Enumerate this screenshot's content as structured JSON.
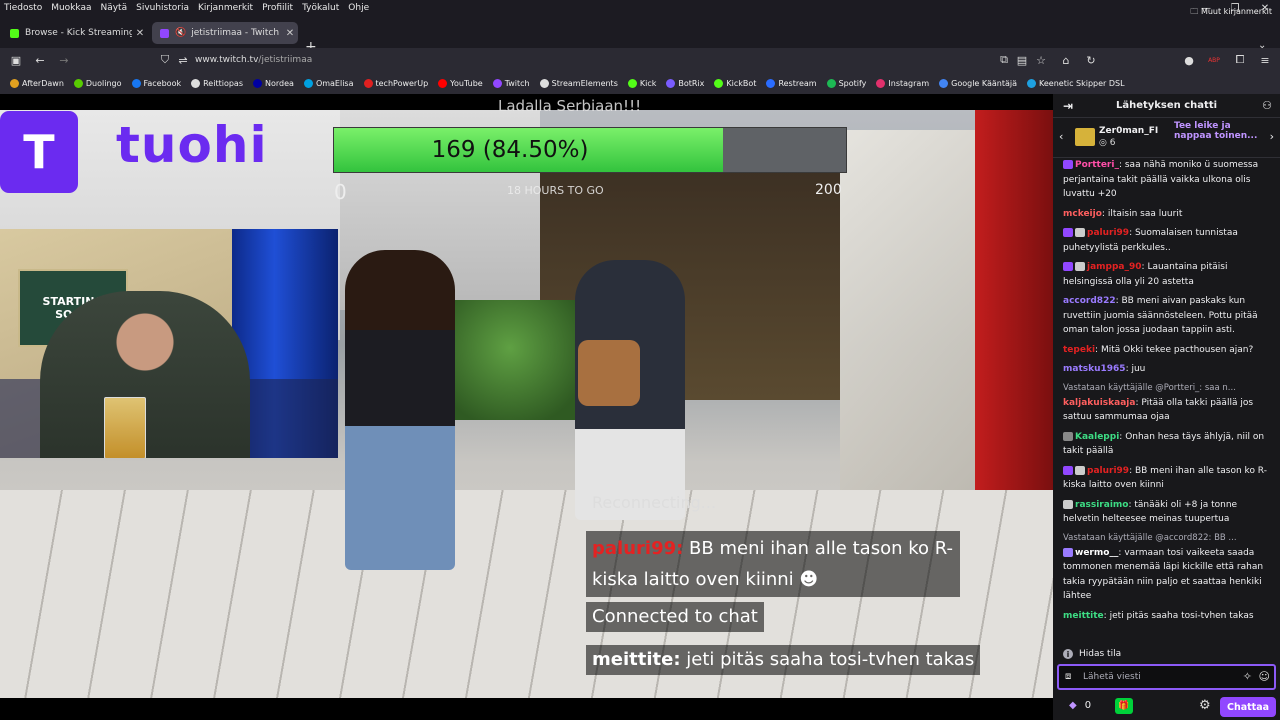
{
  "menubar": {
    "items": [
      "Tiedosto",
      "Muokkaa",
      "Näytä",
      "Sivuhistoria",
      "Kirjanmerkit",
      "Profiilit",
      "Työkalut",
      "Ohje"
    ],
    "minimize_icon": "minimize-icon",
    "restore_icon": "restore-icon",
    "close_icon": "close-icon"
  },
  "tabs": [
    {
      "title": "Browse - Kick Streaming",
      "favicon_color": "#53fc18",
      "active": false
    },
    {
      "title": "jetistriimaa - Twitch",
      "favicon_color": "#9147ff",
      "active": true,
      "audio_icon": "speaker-muted-icon"
    }
  ],
  "nav": {
    "url_host": "www.twitch.tv",
    "url_path": "/jetistriimaa",
    "extension_badge": "ABP"
  },
  "bookmarks": [
    {
      "label": "AfterDawn",
      "color": "#e0a020"
    },
    {
      "label": "Duolingo",
      "color": "#58cc02"
    },
    {
      "label": "Facebook",
      "color": "#1877f2"
    },
    {
      "label": "Reittiopas",
      "color": "#dddddd"
    },
    {
      "label": "Nordea",
      "color": "#0000a0"
    },
    {
      "label": "OmaElisa",
      "color": "#00a0e0"
    },
    {
      "label": "techPowerUp",
      "color": "#e02020"
    },
    {
      "label": "YouTube",
      "color": "#ff0000"
    },
    {
      "label": "Twitch",
      "color": "#9147ff"
    },
    {
      "label": "StreamElements",
      "color": "#dddddd"
    },
    {
      "label": "Kick",
      "color": "#53fc18"
    },
    {
      "label": "BotRix",
      "color": "#7a5cff"
    },
    {
      "label": "KickBot",
      "color": "#53fc18"
    },
    {
      "label": "Restream",
      "color": "#2a6cff"
    },
    {
      "label": "Spotify",
      "color": "#1db954"
    },
    {
      "label": "Instagram",
      "color": "#e1306c"
    },
    {
      "label": "Google Kääntäjä",
      "color": "#4285f4"
    },
    {
      "label": "Keenetic Skipper DSL",
      "color": "#1ea0e0"
    }
  ],
  "other_bookmarks": "Muut kirjanmerkit",
  "stream": {
    "logo_letter": "T",
    "logo_word": "tuohi",
    "goal_title": "Ladalla Serbiaan!!!",
    "goal_text": "169 (84.50%)",
    "goal_progress": 0.845,
    "goal_min": "0",
    "goal_max": "200",
    "goal_sub": "18 HOURS TO GO",
    "cam_sign": "STARTING SOON",
    "reconnecting": "Reconnecting...",
    "overlay_msg_user": "paluri99:",
    "overlay_msg_text": "BB meni ihan alle tason ko R-kiska laitto oven kiinni",
    "connected": "Connected to chat",
    "last_user": "meittite:",
    "last_text": "jeti pitäs saaha tosi-tvhen takas"
  },
  "chat": {
    "title": "Lähetyksen chatti",
    "gifter_name": "Zer0man_FI",
    "gifter_count": "6",
    "clip_prompt": "Tee leike ja nappaa toinen...",
    "messages": [
      {
        "user": "Portteri_",
        "color": "#ff4fa8",
        "text": "saa nähä moniko ü suomessa perjantaina takit päällä vaikka ulkona olis luvattu +20",
        "badges": [
          "#9147ff"
        ]
      },
      {
        "user": "mckeijo",
        "color": "#ff5f5f",
        "text": "iltaisin saa luurit",
        "badges": []
      },
      {
        "user": "paluri99",
        "color": "#e42222",
        "text": "Suomalaisen tunnistaa puhetyylistä perkkules..",
        "badges": [
          "#9147ff",
          "#cccccc"
        ]
      },
      {
        "user": "jamppa_90",
        "color": "#e42222",
        "text": "Lauantaina pitäisi helsingissä olla yli 20 astetta",
        "badges": [
          "#9147ff",
          "#cccccc"
        ]
      },
      {
        "user": "accord822",
        "color": "#9a7bff",
        "text": "BB meni aivan paskaks kun ruvettiin juomia säännösteleen. Pottu pitää oman talon jossa juodaan tappiin asti.",
        "badges": []
      },
      {
        "user": "tepeki",
        "color": "#e42222",
        "text": "Mitä Okki tekee pacthousen ajan?",
        "badges": []
      },
      {
        "user": "matsku1965",
        "color": "#9a7bff",
        "text": "juu",
        "badges": []
      },
      {
        "reply": "Vastataan käyttäjälle @Portteri_: saa n...",
        "user": "kaljakuiskaaja",
        "color": "#ff5f5f",
        "text": "Pitää olla takki päällä jos sattuu sammumaa ojaa",
        "badges": []
      },
      {
        "user": "Kaaleppi",
        "color": "#3ddc84",
        "text": "Onhan hesa täys ählyjä, niil on takit päällä",
        "badges": [
          "#888888"
        ]
      },
      {
        "user": "paluri99",
        "color": "#e42222",
        "text": "BB meni ihan alle tason ko R-kiska laitto oven kiinni",
        "badges": [
          "#9147ff",
          "#cccccc"
        ]
      },
      {
        "user": "rassiraimo",
        "color": "#3ddc84",
        "text": "tänääki oli +8 ja tonne helvetin helteesee meinas tuupertua",
        "badges": [
          "#cccccc"
        ]
      },
      {
        "reply": "Vastataan käyttäjälle @accord822: BB ...",
        "user": "wermo__",
        "color": "#ffffff",
        "text": "varmaan tosi vaikeeta saada tommonen menemää läpi kickille että rahan takia ryypätään niin paljo et saattaa henkiki lähtee",
        "badges": [
          "#9a7bff"
        ]
      },
      {
        "user": "meittite",
        "color": "#3ddc84",
        "text": "jeti pitäs saaha tosi-tvhen takas",
        "badges": []
      }
    ],
    "slow_mode": "Hidas tila",
    "input_placeholder": "Lähetä viesti",
    "points": "0",
    "send_label": "Chattaa"
  }
}
